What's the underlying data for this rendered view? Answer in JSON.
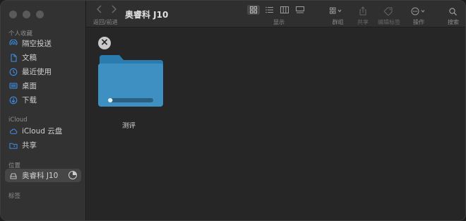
{
  "sidebar": {
    "sections": [
      {
        "title": "个人收藏",
        "items": [
          {
            "label": "隔空投送",
            "icon": "airdrop-icon"
          },
          {
            "label": "文稿",
            "icon": "document-icon"
          },
          {
            "label": "最近使用",
            "icon": "clock-icon"
          },
          {
            "label": "桌面",
            "icon": "desktop-icon"
          },
          {
            "label": "下载",
            "icon": "download-icon"
          }
        ]
      },
      {
        "title": "iCloud",
        "items": [
          {
            "label": "iCloud 云盘",
            "icon": "cloud-icon"
          },
          {
            "label": "共享",
            "icon": "shared-folder-icon"
          }
        ]
      },
      {
        "title": "位置",
        "items": [
          {
            "label": "奥睿科 J10",
            "icon": "drive-icon"
          }
        ]
      },
      {
        "title": "标签",
        "items": []
      }
    ]
  },
  "toolbar": {
    "nav_label": "返回/前进",
    "title": "奥睿科 J10",
    "display_label": "显示",
    "group_label": "群组",
    "share_label": "共享",
    "tags_label": "编辑标签",
    "action_label": "操作",
    "search_label": "搜索"
  },
  "content": {
    "folder_name": "测评",
    "progress": 0.1
  }
}
